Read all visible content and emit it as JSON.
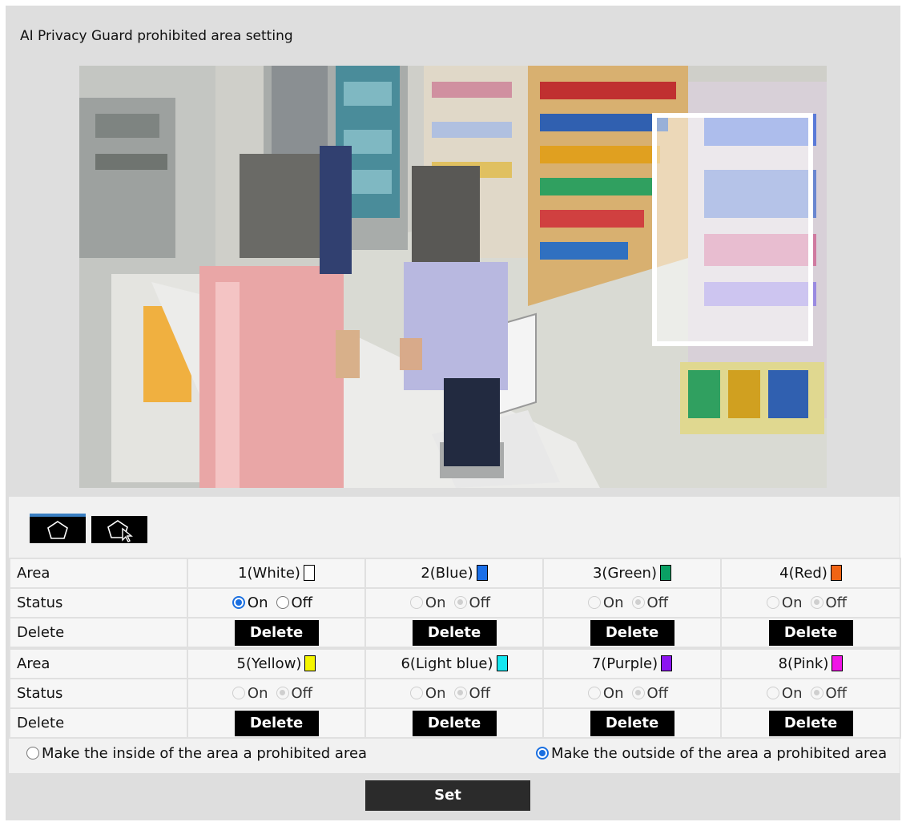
{
  "title": "AI Privacy Guard prohibited area setting",
  "tools": [
    {
      "name": "draw-polygon-tool",
      "icon": "pentagon-icon",
      "active": true
    },
    {
      "name": "select-area-tool",
      "icon": "pentagon-cursor-icon",
      "active": false
    }
  ],
  "labels": {
    "area": "Area",
    "status": "Status",
    "delete": "Delete"
  },
  "radio_labels": {
    "on": "On",
    "off": "Off"
  },
  "delete_label": "Delete",
  "areas_row1": [
    {
      "name": "1(White)",
      "color": "#ffffff",
      "status": "On",
      "enabled": true
    },
    {
      "name": "2(Blue)",
      "color": "#1a6fe8",
      "status": "Off",
      "enabled": false
    },
    {
      "name": "3(Green)",
      "color": "#0aa064",
      "status": "Off",
      "enabled": false
    },
    {
      "name": "4(Red)",
      "color": "#f06414",
      "status": "Off",
      "enabled": false
    }
  ],
  "areas_row2": [
    {
      "name": "5(Yellow)",
      "color": "#f5f500",
      "status": "Off",
      "enabled": false
    },
    {
      "name": "6(Light blue)",
      "color": "#14e6f0",
      "status": "Off",
      "enabled": false
    },
    {
      "name": "7(Purple)",
      "color": "#8c14f0",
      "status": "Off",
      "enabled": false
    },
    {
      "name": "8(Pink)",
      "color": "#f014e6",
      "status": "Off",
      "enabled": false
    }
  ],
  "mode": {
    "inside_label": "Make the inside of the area a prohibited area",
    "outside_label": "Make the outside of the area a prohibited area",
    "selected": "outside"
  },
  "set_label": "Set"
}
